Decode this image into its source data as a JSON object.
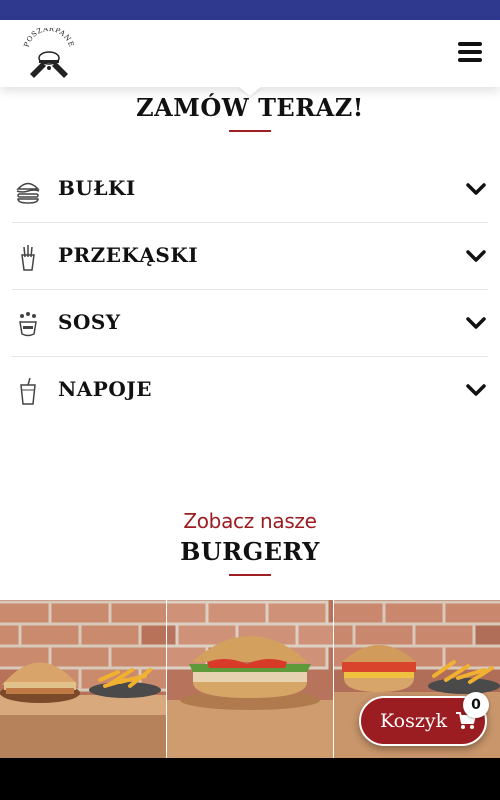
{
  "header": {
    "logo_text": "POSZARPANE",
    "logo_icon": "burger-with-crossed-cleavers",
    "menu_icon": "hamburger-menu-icon"
  },
  "order": {
    "title": "ZAMÓW TERAZ!"
  },
  "categories": [
    {
      "label": "BUŁKI",
      "icon": "burger-icon"
    },
    {
      "label": "PRZEKĄSKI",
      "icon": "fries-icon"
    },
    {
      "label": "SOSY",
      "icon": "sauce-icon"
    },
    {
      "label": "NAPOJE",
      "icon": "drink-cup-icon"
    }
  ],
  "burgers": {
    "intro": "Zobacz nasze",
    "title": "BURGERY"
  },
  "cart": {
    "label": "Koszyk",
    "count": "0",
    "icon": "shopping-cart-icon"
  },
  "colors": {
    "top_bar": "#2f3a8f",
    "accent": "#9b1d22",
    "bottom_bar": "#000000"
  }
}
